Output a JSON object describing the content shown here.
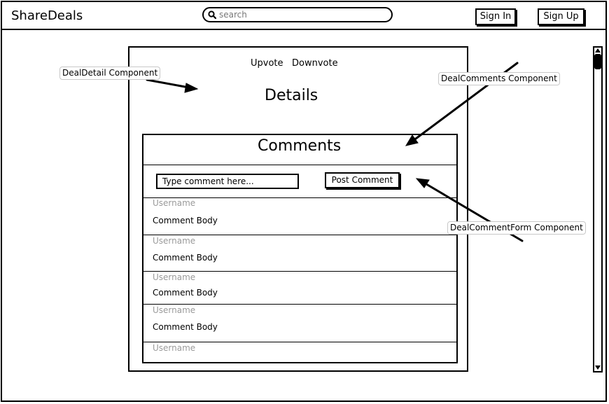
{
  "header": {
    "brand": "ShareDeals",
    "search_placeholder": "search",
    "sign_in_label": "Sign In",
    "sign_up_label": "Sign Up"
  },
  "deal_detail": {
    "upvote_label": "Upvote",
    "downvote_label": "Downvote",
    "title": "Details"
  },
  "comments": {
    "title": "Comments",
    "input_placeholder": "Type comment here...",
    "post_label": "Post Comment",
    "items": [
      {
        "username": "Username",
        "body": "Comment Body"
      },
      {
        "username": "Username",
        "body": "Comment Body"
      },
      {
        "username": "Username",
        "body": "Comment Body"
      },
      {
        "username": "Username",
        "body": "Comment Body"
      },
      {
        "username": "Username"
      }
    ]
  },
  "annotations": {
    "deal_detail": "DealDetail Component",
    "deal_comments": "DealComments Component",
    "deal_comment_form": "DealCommentForm Component"
  },
  "icons": {
    "search": "search-icon",
    "scroll_up": "arrow-up-icon",
    "scroll_down": "arrow-down-icon"
  }
}
